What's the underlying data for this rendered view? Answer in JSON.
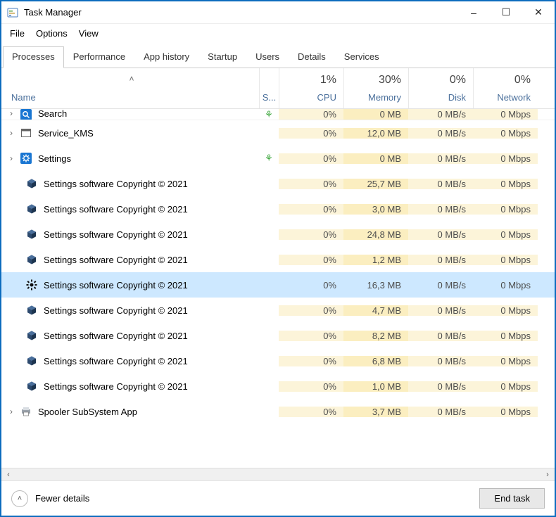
{
  "window": {
    "title": "Task Manager",
    "min": "–",
    "max": "☐",
    "close": "✕"
  },
  "menu": {
    "file": "File",
    "options": "Options",
    "view": "View"
  },
  "tabs": {
    "processes": "Processes",
    "performance": "Performance",
    "app_history": "App history",
    "startup": "Startup",
    "users": "Users",
    "details": "Details",
    "services": "Services"
  },
  "columns": {
    "name": "Name",
    "status": "S...",
    "cpu_pct": "1%",
    "cpu": "CPU",
    "mem_pct": "30%",
    "mem": "Memory",
    "disk_pct": "0%",
    "disk": "Disk",
    "net_pct": "0%",
    "net": "Network",
    "sort_indicator": "˄"
  },
  "rows": [
    {
      "name": "Search",
      "expandable": true,
      "icon": "search-app-icon",
      "leaf": true,
      "cpu": "0%",
      "mem": "0 MB",
      "disk": "0 MB/s",
      "net": "0 Mbps",
      "partial_top": true
    },
    {
      "name": "Service_KMS",
      "expandable": true,
      "icon": "window-icon",
      "leaf": false,
      "cpu": "0%",
      "mem": "12,0 MB",
      "disk": "0 MB/s",
      "net": "0 Mbps"
    },
    {
      "name": "Settings",
      "expandable": true,
      "icon": "gear-app-icon",
      "leaf": true,
      "cpu": "0%",
      "mem": "0 MB",
      "disk": "0 MB/s",
      "net": "0 Mbps"
    },
    {
      "name": "Settings software Copyright © 2021",
      "expandable": false,
      "icon": "cube-icon",
      "cpu": "0%",
      "mem": "25,7 MB",
      "disk": "0 MB/s",
      "net": "0 Mbps"
    },
    {
      "name": "Settings software Copyright © 2021",
      "expandable": false,
      "icon": "cube-icon",
      "cpu": "0%",
      "mem": "3,0 MB",
      "disk": "0 MB/s",
      "net": "0 Mbps"
    },
    {
      "name": "Settings software Copyright © 2021",
      "expandable": false,
      "icon": "cube-icon",
      "cpu": "0%",
      "mem": "24,8 MB",
      "disk": "0 MB/s",
      "net": "0 Mbps"
    },
    {
      "name": "Settings software Copyright © 2021",
      "expandable": false,
      "icon": "cube-icon",
      "cpu": "0%",
      "mem": "1,2 MB",
      "disk": "0 MB/s",
      "net": "0 Mbps"
    },
    {
      "name": "Settings software Copyright © 2021",
      "expandable": false,
      "icon": "gear-black-icon",
      "cpu": "0%",
      "mem": "16,3 MB",
      "disk": "0 MB/s",
      "net": "0 Mbps",
      "selected": true
    },
    {
      "name": "Settings software Copyright © 2021",
      "expandable": false,
      "icon": "cube-icon",
      "cpu": "0%",
      "mem": "4,7 MB",
      "disk": "0 MB/s",
      "net": "0 Mbps"
    },
    {
      "name": "Settings software Copyright © 2021",
      "expandable": false,
      "icon": "cube-icon",
      "cpu": "0%",
      "mem": "8,2 MB",
      "disk": "0 MB/s",
      "net": "0 Mbps"
    },
    {
      "name": "Settings software Copyright © 2021",
      "expandable": false,
      "icon": "cube-icon",
      "cpu": "0%",
      "mem": "6,8 MB",
      "disk": "0 MB/s",
      "net": "0 Mbps"
    },
    {
      "name": "Settings software Copyright © 2021",
      "expandable": false,
      "icon": "cube-icon",
      "cpu": "0%",
      "mem": "1,0 MB",
      "disk": "0 MB/s",
      "net": "0 Mbps"
    },
    {
      "name": "Spooler SubSystem App",
      "expandable": true,
      "icon": "printer-icon",
      "cpu": "0%",
      "mem": "3,7 MB",
      "disk": "0 MB/s",
      "net": "0 Mbps"
    }
  ],
  "footer": {
    "fewer": "Fewer details",
    "end_task": "End task"
  },
  "scroll": {
    "left": "‹",
    "right": "›"
  }
}
